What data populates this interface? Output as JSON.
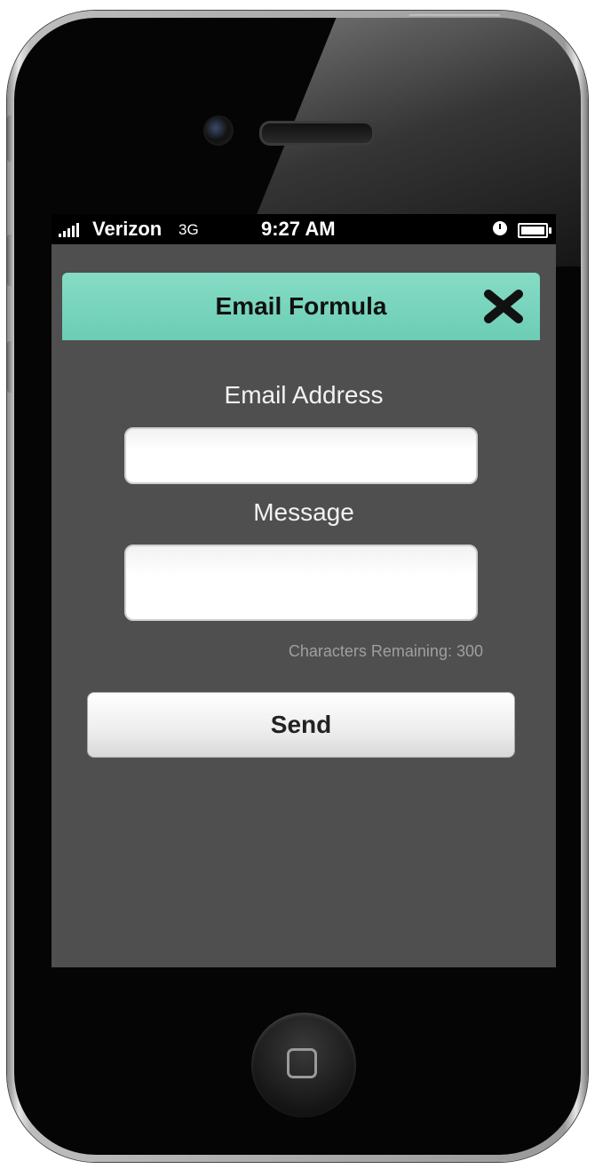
{
  "status_bar": {
    "carrier": "Verizon",
    "network": "3G",
    "time": "9:27 AM"
  },
  "dialog": {
    "title": "Email Formula",
    "email_label": "Email Address",
    "email_value": "",
    "message_label": "Message",
    "message_value": "",
    "characters_remaining": "Characters Remaining: 300",
    "send_label": "Send"
  },
  "colors": {
    "header": "#6ccdb4",
    "screen_background": "#4f4f4f"
  },
  "icons": [
    "signal-icon",
    "alarm-icon",
    "battery-icon",
    "close-icon",
    "home-icon"
  ]
}
